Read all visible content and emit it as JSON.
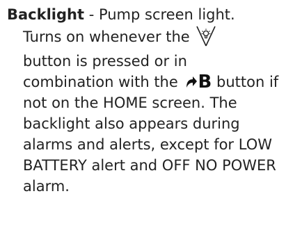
{
  "entry": {
    "term": "Backlight",
    "separator": " - ",
    "definition": "Pump screen light.",
    "line1": "Turns on whenever the",
    "line2": "button is pressed or in combination with the",
    "b_letter": "B",
    "line3": "button if not on the HOME screen. The backlight also appears during alarms and alerts, except for LOW BATTERY alert and OFF NO POWER alarm."
  },
  "icons": {
    "backlight_button_icon": "backlight-icon",
    "act_button_icon": "act-arrow-icon"
  }
}
